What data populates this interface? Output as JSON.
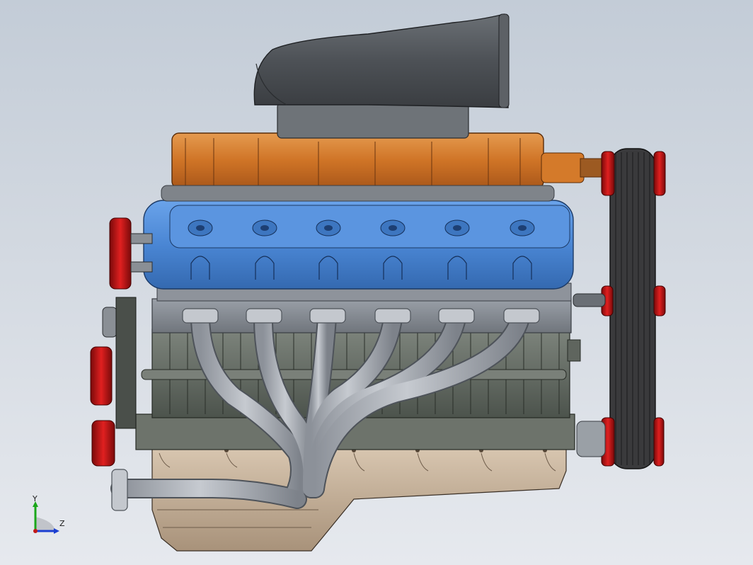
{
  "viewport": {
    "background_top": "#c3ccd7",
    "background_bottom": "#e6e9ee"
  },
  "model": {
    "parts": [
      {
        "name": "intake-scoop",
        "color": "#55595e"
      },
      {
        "name": "supercharger",
        "color": "#d47a2a"
      },
      {
        "name": "cylinder-head",
        "color": "#4a86d4"
      },
      {
        "name": "engine-block",
        "color": "#6a7068"
      },
      {
        "name": "exhaust-headers",
        "color": "#a9adb4"
      },
      {
        "name": "oil-pan",
        "color": "#c9b49c"
      },
      {
        "name": "pulleys",
        "color": "#cc1a1a"
      },
      {
        "name": "drive-belt",
        "color": "#3a3a3c"
      }
    ]
  },
  "triad": {
    "y_label": "Y",
    "z_label": "Z",
    "y_color": "#1aa71a",
    "z_color": "#1b3fd1"
  }
}
